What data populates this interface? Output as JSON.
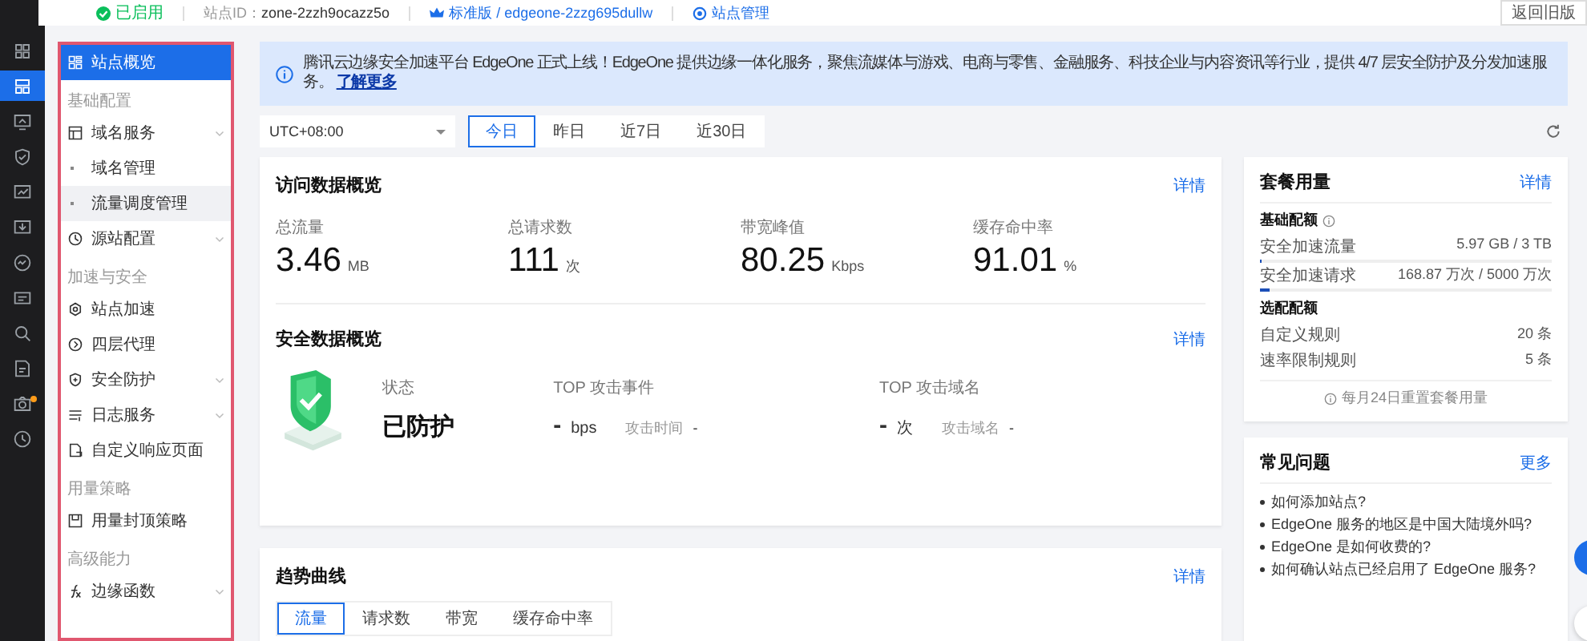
{
  "rail": {
    "items": [
      {
        "kind": "grid",
        "selected": false
      },
      {
        "kind": "layout",
        "selected": true
      },
      {
        "kind": "monitor",
        "selected": false
      },
      {
        "kind": "shield",
        "selected": false
      },
      {
        "kind": "chart",
        "selected": false
      },
      {
        "kind": "download",
        "selected": false
      },
      {
        "kind": "gauge",
        "selected": false
      },
      {
        "kind": "card",
        "selected": false
      },
      {
        "kind": "search",
        "selected": false
      },
      {
        "kind": "doc",
        "selected": false
      },
      {
        "kind": "camera",
        "selected": false,
        "badge": true
      },
      {
        "kind": "clock",
        "selected": false
      }
    ]
  },
  "header": {
    "status": "已启用",
    "site_id_label": "站点ID：",
    "site_id": "zone-2zzh9ocazz5o",
    "plan": "标准版 / edgeone-2zzg695dullw",
    "manage": "站点管理",
    "back_button": "返回旧版"
  },
  "sidebar": {
    "items": [
      {
        "kind": "item",
        "label": "站点概览",
        "selected": true
      },
      {
        "kind": "group",
        "label": "基础配置"
      },
      {
        "kind": "item",
        "label": "域名服务",
        "selected": false,
        "expandable": true
      },
      {
        "kind": "sub",
        "label": "域名管理",
        "selected": false,
        "hovered": false
      },
      {
        "kind": "sub",
        "label": "流量调度管理",
        "selected": false,
        "hovered": true
      },
      {
        "kind": "item",
        "label": "源站配置",
        "selected": false,
        "expandable": true
      },
      {
        "kind": "group",
        "label": "加速与安全"
      },
      {
        "kind": "item",
        "label": "站点加速",
        "selected": false
      },
      {
        "kind": "item",
        "label": "四层代理",
        "selected": false
      },
      {
        "kind": "item",
        "label": "安全防护",
        "selected": false,
        "expandable": true
      },
      {
        "kind": "item",
        "label": "日志服务",
        "selected": false,
        "expandable": true
      },
      {
        "kind": "item",
        "label": "自定义响应页面",
        "selected": false
      },
      {
        "kind": "group",
        "label": "用量策略"
      },
      {
        "kind": "item",
        "label": "用量封顶策略",
        "selected": false
      },
      {
        "kind": "group",
        "label": "高级能力"
      },
      {
        "kind": "item",
        "label": "边缘函数",
        "selected": false,
        "expandable": true
      }
    ]
  },
  "notice": {
    "text": "腾讯云边缘安全加速平台 EdgeOne 正式上线！EdgeOne 提供边缘一体化服务，聚焦流媒体与游戏、电商与零售、金融服务、科技企业与内容资讯等行业，提供 4/7 层安全防护及分发加速服务。",
    "link": "了解更多"
  },
  "filters": {
    "timezone": "UTC+08:00",
    "ranges": [
      {
        "label": "今日",
        "selected": true
      },
      {
        "label": "昨日",
        "selected": false
      },
      {
        "label": "近7日",
        "selected": false
      },
      {
        "label": "近30日",
        "selected": false
      }
    ]
  },
  "access_overview": {
    "title": "访问数据概览",
    "detail": "详情",
    "metrics": [
      {
        "label": "总流量",
        "value": "3.46",
        "unit": "MB"
      },
      {
        "label": "总请求数",
        "value": "111",
        "unit": "次"
      },
      {
        "label": "带宽峰值",
        "value": "80.25",
        "unit": "Kbps"
      },
      {
        "label": "缓存命中率",
        "value": "91.01",
        "unit": "%"
      }
    ]
  },
  "security_overview": {
    "title": "安全数据概览",
    "detail": "详情",
    "status_label": "状态",
    "status": "已防护",
    "columns": [
      {
        "label": "TOP 攻击事件",
        "value": "-",
        "unit": "bps",
        "sub_label": "攻击时间",
        "sub_value": "-"
      },
      {
        "label": "TOP 攻击域名",
        "value": "-",
        "unit": "次",
        "sub_label": "攻击域名",
        "sub_value": "-"
      }
    ]
  },
  "trend": {
    "title": "趋势曲线",
    "detail": "详情",
    "tabs": [
      {
        "label": "流量",
        "selected": true
      },
      {
        "label": "请求数",
        "selected": false
      },
      {
        "label": "带宽",
        "selected": false
      },
      {
        "label": "缓存命中率",
        "selected": false
      }
    ]
  },
  "plan_usage": {
    "title": "套餐用量",
    "detail": "详情",
    "sections": [
      {
        "title": "基础配额",
        "info": true,
        "rows": [
          {
            "label": "安全加速流量",
            "value": "5.97 GB / 3 TB",
            "level": 0.002
          },
          {
            "label": "安全加速请求",
            "value": "168.87 万次 / 5000 万次",
            "level": 0.034
          }
        ]
      },
      {
        "title": "选配配额",
        "rows": [
          {
            "label": "自定义规则",
            "value": "20 条"
          },
          {
            "label": "速率限制规则",
            "value": "5 条"
          }
        ]
      }
    ],
    "footer": "每月24日重置套餐用量"
  },
  "faq": {
    "title": "常见问题",
    "more": "更多",
    "items": [
      "如何添加站点?",
      "EdgeOne 服务的地区是中国大陆境外吗?",
      "EdgeOne 是如何收费的?",
      "如何确认站点已经启用了 EdgeOne 服务?"
    ]
  }
}
